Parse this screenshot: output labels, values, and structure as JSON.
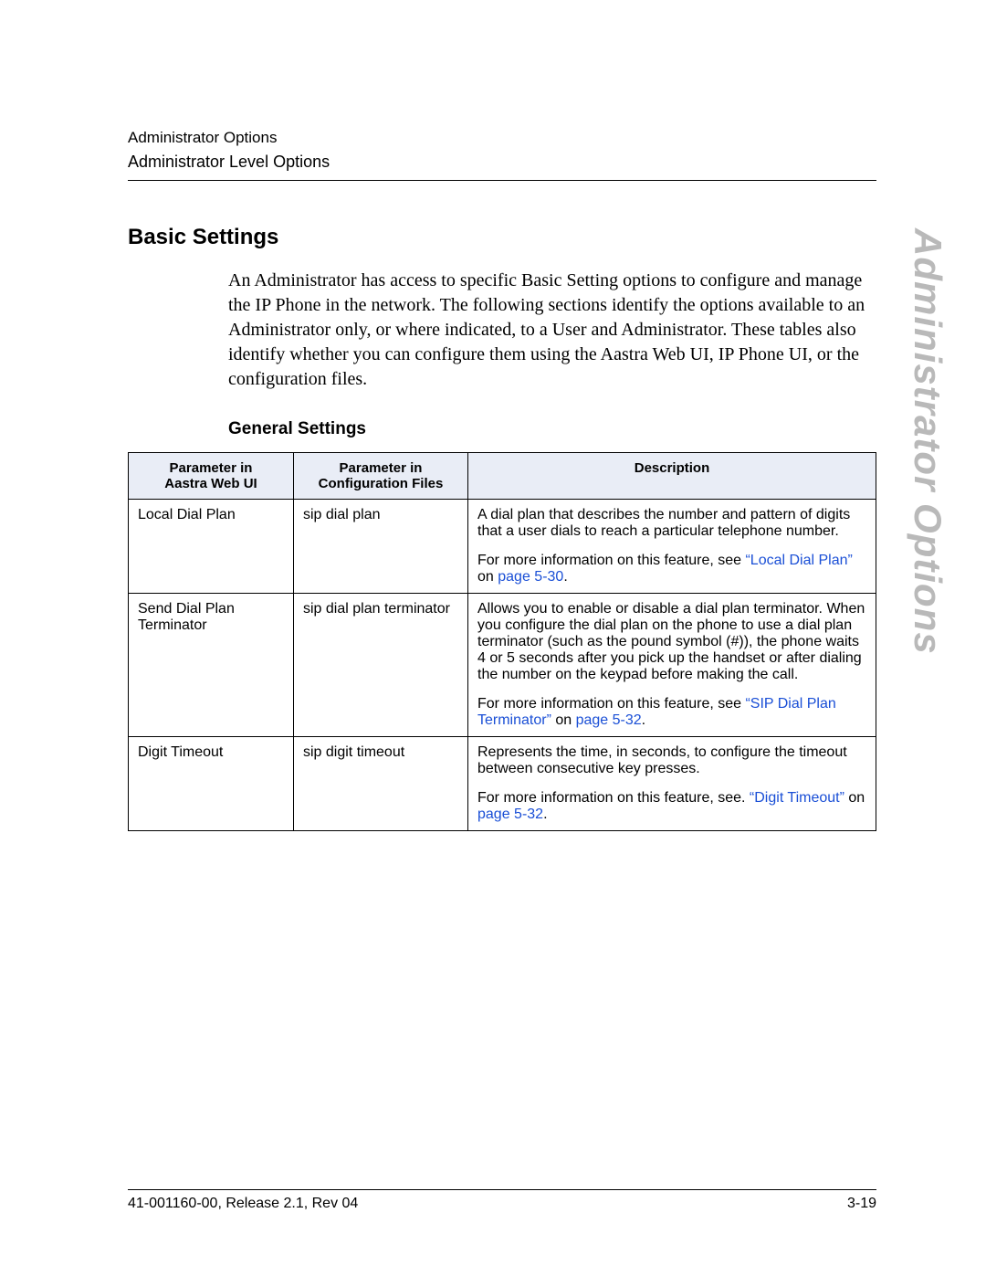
{
  "header": {
    "chapter": "Administrator Options",
    "section": "Administrator Level Options"
  },
  "side_tab": "Administrator Options",
  "heading": "Basic Settings",
  "intro": "An Administrator has access to specific Basic Setting options to configure and manage the IP Phone in the network. The following sections identify the options available to an Administrator only, or where indicated, to a User and Administrator. These tables also identify whether you can configure them using the Aastra Web UI, IP Phone UI, or the configuration files.",
  "subsection": "General Settings",
  "table": {
    "headers": {
      "col_a_line1": "Parameter in",
      "col_a_line2": "Aastra Web UI",
      "col_b_line1": "Parameter in",
      "col_b_line2": "Configuration Files",
      "col_c": "Description"
    },
    "rows": [
      {
        "web": "Local Dial Plan",
        "cfg": "sip dial plan",
        "desc1": "A dial plan that describes the number and pattern of digits that a user dials to reach a particular telephone number.",
        "more_prefix": "For more information on this feature, see ",
        "link": "“Local Dial Plan”",
        "on": " on ",
        "page": "page 5-30",
        "tail": "."
      },
      {
        "web": "Send Dial Plan Terminator",
        "cfg": "sip dial plan terminator",
        "desc1": "Allows you to enable or disable a dial plan terminator. When you configure the dial plan on the phone to use a dial plan terminator (such as the pound symbol (#)), the phone waits 4 or 5 seconds after you pick up the handset or after dialing the number on the keypad before making the call.",
        "more_prefix": "For more information on this feature, see ",
        "link": "“SIP Dial Plan Terminator”",
        "on": " on ",
        "page": "page 5-32",
        "tail": "."
      },
      {
        "web": "Digit Timeout",
        "cfg": "sip digit timeout",
        "desc1": "Represents the time, in seconds, to configure the timeout between consecutive key presses.",
        "more_prefix": "For more information on this feature, see. ",
        "link": "“Digit Timeout”",
        "on": " on ",
        "page": "page 5-32",
        "tail": "."
      }
    ]
  },
  "footer": {
    "left": "41-001160-00, Release 2.1, Rev 04",
    "right": "3-19"
  }
}
